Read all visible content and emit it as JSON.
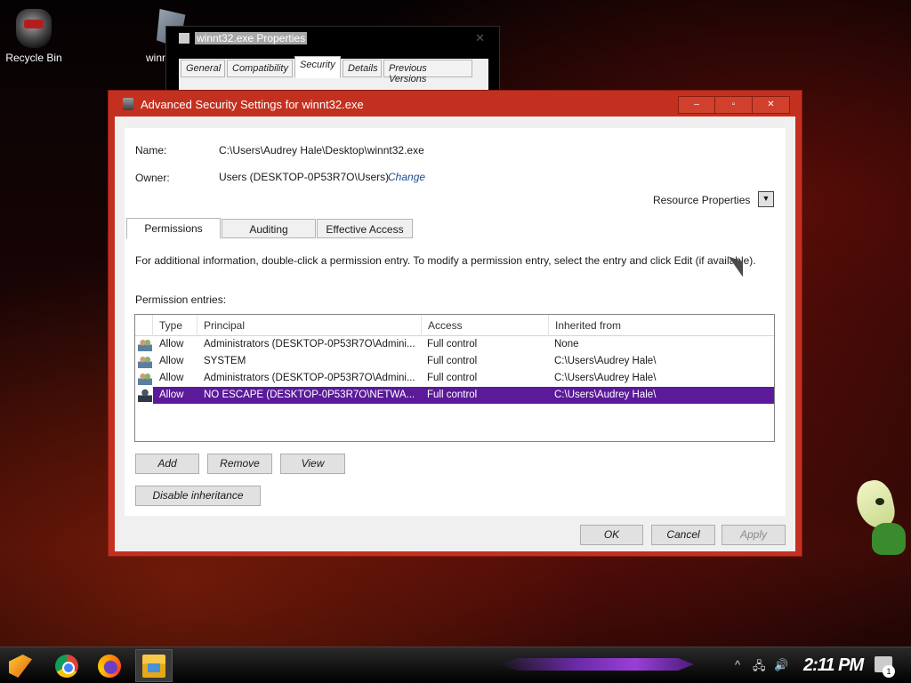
{
  "desktop": {
    "icons": [
      {
        "label": "Recycle Bin"
      },
      {
        "label": "winn"
      }
    ]
  },
  "bg_window": {
    "title": "winnt32.exe Properties",
    "close": "✕",
    "tabs": [
      "General",
      "Compatibility",
      "Security",
      "Details",
      "Previous Versions"
    ]
  },
  "dialog": {
    "title": "Advanced Security Settings for winnt32.exe",
    "window_buttons": {
      "minimize": "–",
      "maximize": "▫",
      "close": "✕"
    },
    "name_label": "Name:",
    "name_value": "C:\\Users\\Audrey Hale\\Desktop\\winnt32.exe",
    "owner_label": "Owner:",
    "owner_value": "Users (DESKTOP-0P53R7O\\Users)",
    "change_link": "Change",
    "resource_properties": "Resource Properties",
    "tabs": [
      "Permissions",
      "Auditing",
      "Effective Access"
    ],
    "info_text": "For additional information, double-click a permission entry. To modify a permission entry, select the entry and click Edit (if available).",
    "entries_label": "Permission entries:",
    "columns": [
      "Type",
      "Principal",
      "Access",
      "Inherited from"
    ],
    "rows": [
      {
        "icon": "group-icon",
        "type": "Allow",
        "principal": "Administrators (DESKTOP-0P53R7O\\Admini...",
        "access": "Full control",
        "inherited": "None"
      },
      {
        "icon": "group-icon",
        "type": "Allow",
        "principal": "SYSTEM",
        "access": "Full control",
        "inherited": "C:\\Users\\Audrey Hale\\"
      },
      {
        "icon": "group-icon",
        "type": "Allow",
        "principal": "Administrators (DESKTOP-0P53R7O\\Admini...",
        "access": "Full control",
        "inherited": "C:\\Users\\Audrey Hale\\"
      },
      {
        "icon": "user-icon",
        "type": "Allow",
        "principal": "NO ESCAPE (DESKTOP-0P53R7O\\NETWA...",
        "access": "Full control",
        "inherited": "C:\\Users\\Audrey Hale\\",
        "selected": true
      }
    ],
    "buttons": {
      "add": "Add",
      "remove": "Remove",
      "view": "View",
      "disable_inheritance": "Disable inheritance",
      "ok": "OK",
      "cancel": "Cancel",
      "apply": "Apply"
    }
  },
  "taskbar": {
    "apps": [
      "start-icon",
      "chrome-icon",
      "firefox-icon",
      "file-explorer-icon"
    ],
    "tray": {
      "chevron": "^",
      "network": "🖧",
      "volume": "🔊"
    },
    "clock": "2:11 PM",
    "notification_count": "1"
  },
  "colors": {
    "dialog_frame": "#c4301f",
    "selection": "#5a1a9a",
    "link": "#1f4d8f"
  }
}
